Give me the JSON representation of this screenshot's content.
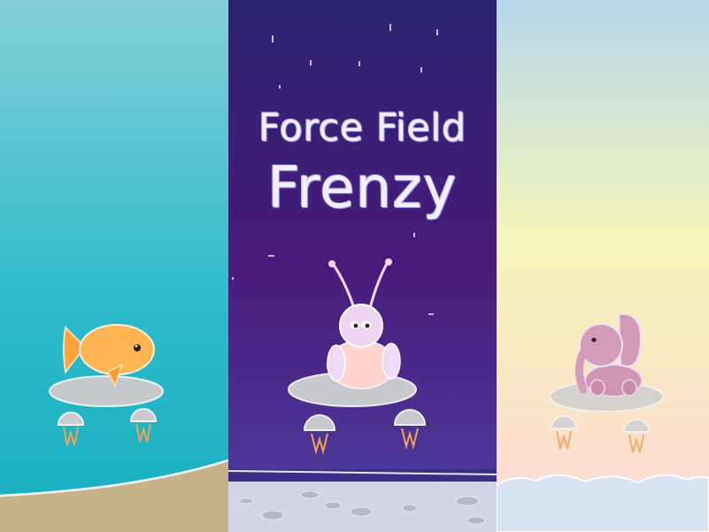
{
  "game": {
    "title_line1": "Force Field",
    "title_line2": "Frenzy"
  },
  "characters": [
    {
      "id": "fish",
      "icon": "goldfish-icon",
      "world": "ocean",
      "color": "#ffb04a"
    },
    {
      "id": "alien",
      "icon": "alien-bug-icon",
      "world": "space",
      "color": "#ffcfd8"
    },
    {
      "id": "elephant",
      "icon": "elephant-icon",
      "world": "sky",
      "color": "#d29bb8"
    }
  ],
  "colors": {
    "ocean_top": "#82cdd6",
    "ocean_bottom": "#1db5c4",
    "sand": "#c9b38a",
    "space_top": "#2b2470",
    "space_bottom": "#4e3f9e",
    "moon_surface": "#cfd3e6",
    "sky_top": "#b9d8ea",
    "sky_mid": "#f6f6b8",
    "sky_bottom": "#fcd9d6",
    "cloud": "#dbe6f4",
    "saucer": "#cfcfcf",
    "thruster_flame": "#f2a15b"
  }
}
